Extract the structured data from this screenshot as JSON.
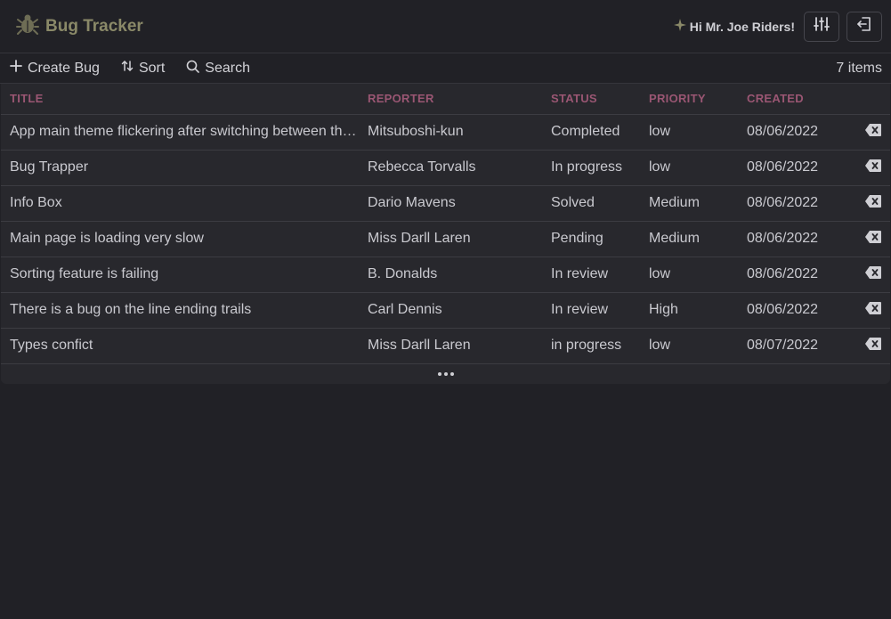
{
  "app": {
    "title": "Bug Tracker",
    "logo_icon": "bug-icon"
  },
  "user": {
    "greeting": "Hi Mr. Joe Riders!",
    "greeting_icon": "sparkle-icon"
  },
  "header_buttons": [
    {
      "name": "settings-button",
      "icon": "sliders-icon"
    },
    {
      "name": "logout-button",
      "icon": "logout-icon"
    }
  ],
  "toolbar": {
    "create_label": "Create Bug",
    "sort_label": "Sort",
    "search_label": "Search",
    "item_count": "7 items"
  },
  "table": {
    "columns": [
      "TITLE",
      "REPORTER",
      "STATUS",
      "PRIORITY",
      "CREATED"
    ],
    "rows": [
      {
        "title": "App main theme flickering after switching between themes",
        "reporter": "Mitsuboshi-kun",
        "status": "Completed",
        "priority": "low",
        "created": "08/06/2022"
      },
      {
        "title": "Bug Trapper",
        "reporter": "Rebecca Torvalls",
        "status": "In progress",
        "priority": "low",
        "created": "08/06/2022"
      },
      {
        "title": "Info Box",
        "reporter": "Dario Mavens",
        "status": "Solved",
        "priority": "Medium",
        "created": "08/06/2022"
      },
      {
        "title": "Main page is loading very slow",
        "reporter": "Miss Darll Laren",
        "status": "Pending",
        "priority": "Medium",
        "created": "08/06/2022"
      },
      {
        "title": "Sorting feature is failing",
        "reporter": "B. Donalds",
        "status": "In review",
        "priority": "low",
        "created": "08/06/2022"
      },
      {
        "title": "There is a bug on the line ending trails",
        "reporter": "Carl Dennis",
        "status": "In review",
        "priority": "High",
        "created": "08/06/2022"
      },
      {
        "title": "Types confict",
        "reporter": "Miss Darll Laren",
        "status": "in progress",
        "priority": "low",
        "created": "08/07/2022"
      }
    ],
    "delete_icon": "backspace-icon",
    "more_icon": "ellipsis-icon"
  },
  "colors": {
    "background": "#212126",
    "brand": "#8a8968",
    "column_header": "#9a5673"
  }
}
